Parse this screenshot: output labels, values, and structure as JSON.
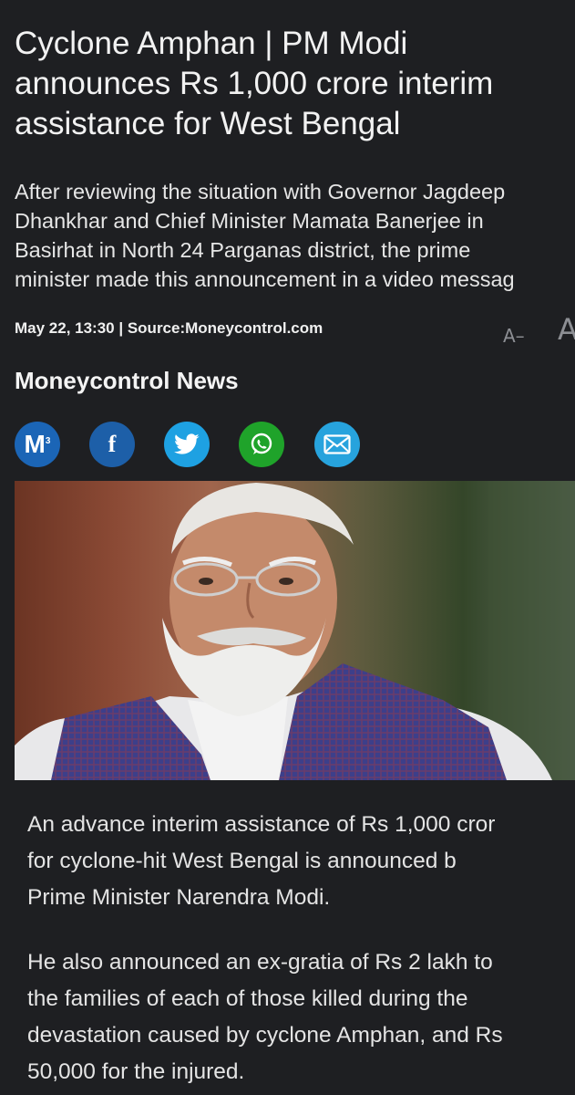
{
  "article": {
    "headline_lines": [
      "Cyclone Amphan | PM Modi",
      "announces Rs 1,000 crore interim",
      "assistance for West Bengal"
    ],
    "summary_lines": [
      "After reviewing the situation with Governor Jagdeep",
      "Dhankhar and Chief Minister Mamata Banerjee in",
      "Basirhat in North 24 Parganas district, the prime",
      "minister made this announcement in a video messag"
    ],
    "meta": "May 22, 13:30 | Source:Moneycontrol.com",
    "font_decrease_label": "A–",
    "font_increase_label": "A",
    "author": "Moneycontrol News",
    "paragraph1_lines": [
      "An advance interim assistance of Rs 1,000 cror",
      "for cyclone-hit West Bengal is announced b",
      "Prime Minister Narendra Modi."
    ],
    "paragraph2_lines": [
      "He also announced an ex-gratia of Rs 2 lakh to",
      "the families of each of those killed during the",
      "devastation caused by cyclone Amphan, and Rs",
      "50,000 for the injured."
    ]
  },
  "share": {
    "moneycontrol_letter": "M",
    "moneycontrol_sup": "3",
    "facebook_letter": "f",
    "icons": [
      "moneycontrol-icon",
      "facebook-icon",
      "twitter-icon",
      "whatsapp-icon",
      "email-icon"
    ]
  },
  "colors": {
    "background": "#1e1f22",
    "text": "#e9e9ea",
    "facebook": "#1d5fa8",
    "twitter": "#1ea1e2",
    "whatsapp": "#1fa32a",
    "email": "#27a3dd"
  }
}
